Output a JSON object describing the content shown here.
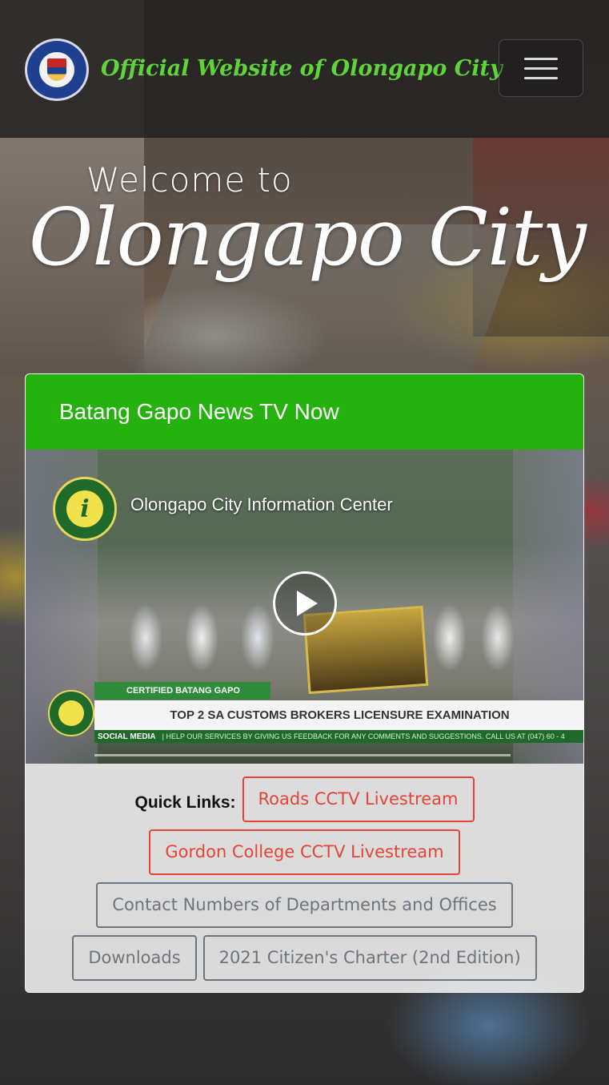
{
  "header": {
    "title": "Official Website of Olongapo City",
    "seal_icon": "city-seal-icon",
    "menu_icon": "hamburger-menu-icon"
  },
  "hero": {
    "welcome": "Welcome to",
    "city": "Olongapo City"
  },
  "news_card": {
    "title": "Batang Gapo News TV Now",
    "video": {
      "channel_name": "Olongapo City Information Center",
      "certified_tag": "CERTIFIED BATANG GAPO",
      "headline": "TOP 2 SA CUSTOMS BROKERS LICENSURE EXAMINATION",
      "ticker_label": "SOCIAL MEDIA",
      "ticker_text": "| HELP OUR SERVICES BY GIVING US FEEDBACK FOR ANY COMMENTS AND SUGGESTIONS. CALL US AT (047) 60 - 4",
      "play_icon": "play-icon"
    }
  },
  "quick_links": {
    "label": "Quick Links:",
    "roads_cctv": "Roads CCTV Livestream",
    "gordon_cctv": "Gordon College CCTV Livestream",
    "contact_numbers": "Contact Numbers of Departments and Offices",
    "downloads": "Downloads",
    "citizens_charter": "2021 Citizen's Charter (2nd Edition)"
  },
  "colors": {
    "title_green": "#5fd33a",
    "card_header_green": "#25b20f",
    "danger_red": "#e44438",
    "secondary_gray": "#6c757d"
  }
}
